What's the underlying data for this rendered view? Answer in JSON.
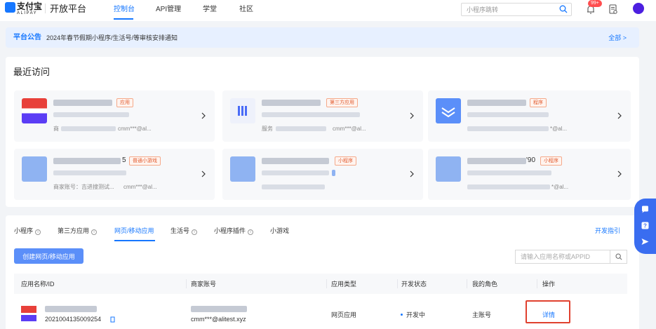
{
  "nav": {
    "logo_text": "支付宝",
    "logo_sub": "ALIPAY",
    "brand": "开放平台",
    "items": [
      "控制台",
      "API管理",
      "学堂",
      "社区"
    ],
    "search_placeholder": "小程序跳转",
    "badge": "99+"
  },
  "announcement": {
    "title": "平台公告",
    "text": "2024年春节假期小程序/生活号/等审核安排通知",
    "all": "全部 >"
  },
  "recent": {
    "title": "最近访问",
    "tiles": [
      {
        "tag": "应用",
        "sub": "商",
        "account": "cmm***@al..."
      },
      {
        "tag": "第三方应用",
        "sub": "服务",
        "account": "cmm***@al..."
      },
      {
        "tag": "程序",
        "sub": "",
        "account": "*@al..."
      },
      {
        "name_suffix": "5",
        "tag": "普通小游戏",
        "sub": "商家账号：吉进搜测试...",
        "account": "cmm***@al..."
      },
      {
        "tag": "小程序",
        "sub": "",
        "account": ""
      },
      {
        "name_suffix": "'90",
        "tag": "小程序",
        "sub": "",
        "account": "*@al..."
      }
    ]
  },
  "apps": {
    "tabs": [
      "小程序",
      "第三方应用",
      "网页/移动应用",
      "生活号",
      "小程序插件",
      "小游戏"
    ],
    "guide": "开发指引",
    "create_button": "创建网页/移动应用",
    "search_placeholder": "请输入应用名称或APPID",
    "columns": [
      "应用名称/ID",
      "商家账号",
      "应用类型",
      "开发状态",
      "我的角色",
      "操作"
    ],
    "row": {
      "app_id": "2021004135009254",
      "account": "cmm***@alitest.xyz",
      "type": "网页应用",
      "status": "开发中",
      "role": "主账号",
      "action": "详情"
    }
  },
  "colors": {
    "accent": "#1677ff",
    "highlight_box": "#e0412f",
    "tag_text": "#e25c30"
  }
}
